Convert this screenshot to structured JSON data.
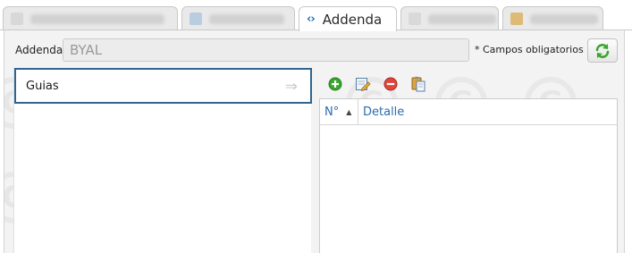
{
  "tabs": [
    {
      "name": "blurred-tab-1",
      "label": "",
      "blurred": true,
      "active": false
    },
    {
      "name": "blurred-tab-2",
      "label": "",
      "blurred": true,
      "active": false
    },
    {
      "name": "tab-addenda",
      "label": "Addenda",
      "blurred": false,
      "active": true,
      "icon": "code-brackets-icon"
    },
    {
      "name": "blurred-tab-3",
      "label": "",
      "blurred": true,
      "active": false
    },
    {
      "name": "blurred-tab-4",
      "label": "",
      "blurred": true,
      "active": false
    }
  ],
  "header": {
    "addenda_label": "Addenda",
    "addenda_value": "BYAL",
    "required_note": "* Campos obligatorios",
    "refresh_icon": "refresh-icon"
  },
  "list": {
    "items": [
      {
        "label": "Guias",
        "selected": true,
        "icon": "arrow-right-icon"
      }
    ]
  },
  "toolbar": {
    "buttons": [
      {
        "icon": "add-icon",
        "color": "#3aa52e"
      },
      {
        "icon": "edit-icon",
        "color": "#d8a33a"
      },
      {
        "icon": "delete-icon",
        "color": "#d93a2f"
      },
      {
        "icon": "copy-icon",
        "color": "#c79a3a"
      }
    ]
  },
  "grid": {
    "columns": [
      "N°",
      "Detalle"
    ],
    "sort_indicator": "▲",
    "rows": []
  },
  "colors": {
    "accent": "#2b6cb0",
    "selection_border": "#2f6590",
    "panel_background": "#f3f3f3"
  }
}
